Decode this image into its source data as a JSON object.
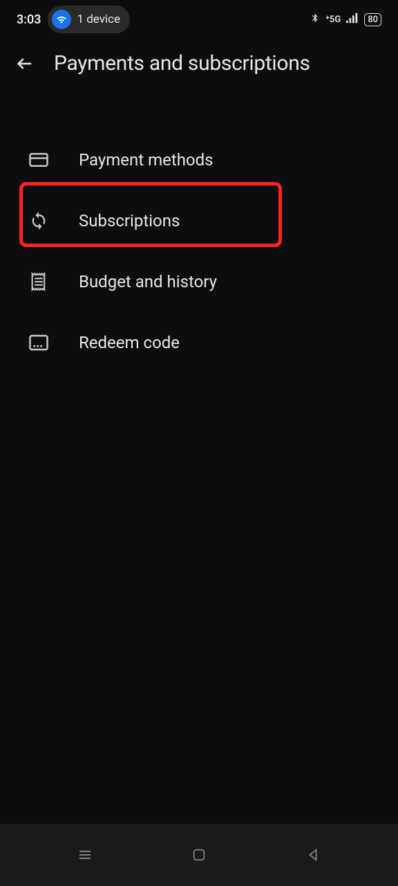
{
  "statusBar": {
    "time": "3:03",
    "deviceCount": "1 device",
    "networkType": "5G",
    "batteryLevel": "80"
  },
  "header": {
    "title": "Payments and subscriptions"
  },
  "menu": {
    "items": [
      {
        "label": "Payment methods"
      },
      {
        "label": "Subscriptions"
      },
      {
        "label": "Budget and history"
      },
      {
        "label": "Redeem code"
      }
    ]
  }
}
